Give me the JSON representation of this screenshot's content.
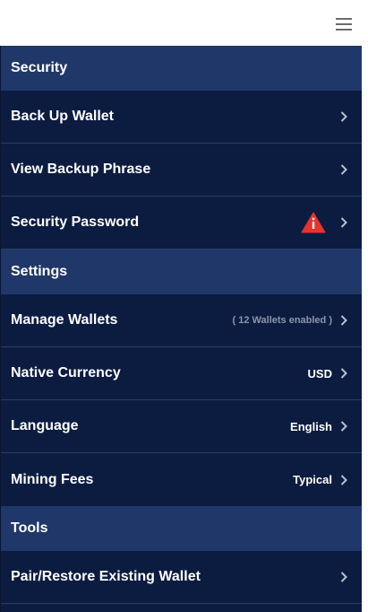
{
  "sections": {
    "security": {
      "title": "Security",
      "items": {
        "backup": "Back Up Wallet",
        "view_phrase": "View Backup Phrase",
        "password": "Security Password"
      }
    },
    "settings": {
      "title": "Settings",
      "items": {
        "manage_wallets": "Manage Wallets",
        "manage_wallets_value": "( 12 Wallets enabled )",
        "currency": "Native Currency",
        "currency_value": "USD",
        "language": "Language",
        "language_value": "English",
        "fees": "Mining Fees",
        "fees_value": "Typical"
      }
    },
    "tools": {
      "title": "Tools",
      "items": {
        "pair_restore": "Pair/Restore Existing Wallet"
      }
    }
  },
  "icons": {
    "menu": "hamburger-icon",
    "chevron": "chevron-right-icon",
    "warning": "warning-icon"
  },
  "colors": {
    "header_bg": "#203869",
    "row_bg": "#0c1c41",
    "warning": "#e8322e"
  }
}
